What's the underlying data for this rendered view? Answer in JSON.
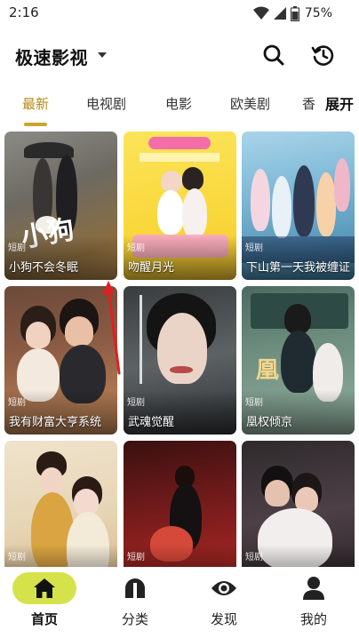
{
  "status_bar": {
    "time": "2:16",
    "battery": "75%",
    "icons": [
      "wifi-icon",
      "signal-icon",
      "battery-icon"
    ]
  },
  "header": {
    "title": "极速影视",
    "icons": [
      "dropdown-caret-icon",
      "search-icon",
      "history-icon"
    ]
  },
  "tabs": {
    "items": [
      "最新",
      "电视剧",
      "电影",
      "欧美剧",
      "香"
    ],
    "active_index": 0,
    "expand_label": "展开"
  },
  "cards": [
    {
      "title": "小狗不会冬眠",
      "badge": "短剧"
    },
    {
      "title": "吻醒月光",
      "badge": "短剧"
    },
    {
      "title": "下山第一天我被缠证",
      "badge": "短剧"
    },
    {
      "title": "我有财富大亨系统",
      "badge": "短剧"
    },
    {
      "title": "武魂觉醒",
      "badge": "短剧"
    },
    {
      "title": "凰权倾京",
      "badge": "短剧"
    },
    {
      "title": "",
      "badge": "短剧"
    },
    {
      "title": "",
      "badge": "短剧"
    },
    {
      "title": "",
      "badge": "短剧"
    }
  ],
  "bottom_nav": {
    "items": [
      {
        "label": "首页",
        "icon": "home-icon"
      },
      {
        "label": "分类",
        "icon": "category-icon"
      },
      {
        "label": "发现",
        "icon": "discover-eye-icon"
      },
      {
        "label": "我的",
        "icon": "profile-icon"
      }
    ],
    "active_index": 0
  },
  "colors": {
    "accent": "#b38a13",
    "nav_active_bg": "#d6e24a",
    "annotation_arrow": "#e02020"
  }
}
